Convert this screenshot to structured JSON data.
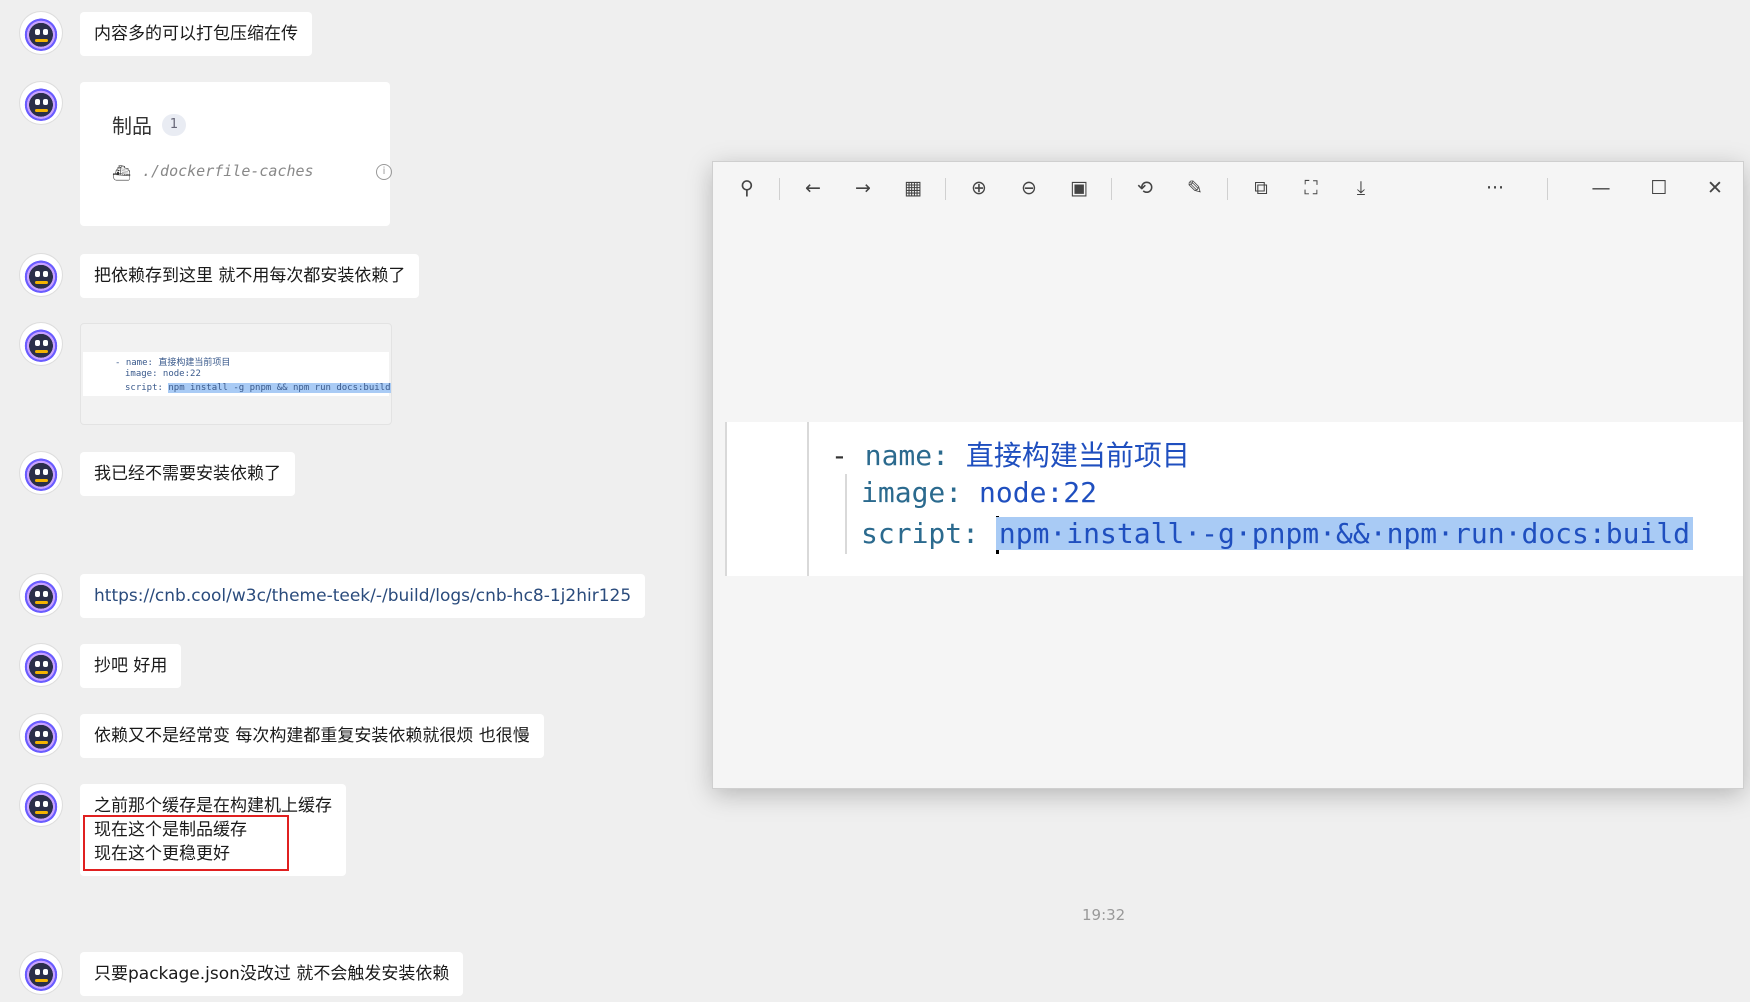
{
  "messages": [
    {
      "text": "内容多的可以打包压缩在传"
    },
    {
      "card": {
        "title": "制品",
        "count": "1",
        "path": "./dockerfile-caches"
      }
    },
    {
      "text": "把依赖存到这里 就不用每次都安装依赖了"
    },
    {
      "thumb": {
        "line1": "- name: 直接构建当前项目",
        "line2": "image: node:22",
        "line3_key": "script:",
        "line3_val": "npm install -g pnpm && npm run docs:build"
      }
    },
    {
      "text": "我已经不需要安装依赖了"
    },
    {
      "link": "https://cnb.cool/w3c/theme-teek/-/build/logs/cnb-hc8-1j2hir125"
    },
    {
      "text": "抄吧 好用"
    },
    {
      "text": "依赖又不是经常变 每次构建都重复安装依赖就很烦 也很慢"
    },
    {
      "lines": [
        "之前那个缓存是在构建机上缓存",
        "现在这个是制品缓存",
        "现在这个更稳更好"
      ]
    },
    {
      "text": "只要package.json没改过 就不会触发安装依赖"
    }
  ],
  "timestamp": "19:32",
  "viewer": {
    "icons": [
      "pin-icon",
      "back-icon",
      "forward-icon",
      "grid-icon",
      "zoom-in-icon",
      "zoom-out-icon",
      "actual-size-icon",
      "rotate-icon",
      "edit-icon",
      "ocr-icon",
      "screen-capture-icon",
      "download-icon",
      "more-icon",
      "minimize-icon",
      "maximize-icon",
      "close-icon"
    ],
    "glyphs": {
      "pin": "⚲",
      "back": "←",
      "forward": "→",
      "grid": "▦",
      "zin": "⊕",
      "zout": "⊖",
      "actual": "▣",
      "rotate": "⟲",
      "edit": "✎",
      "ocr": "⧉",
      "capture": "⛶",
      "download": "⤓",
      "more": "···",
      "min": "—",
      "max": "☐",
      "close": "✕"
    },
    "code": {
      "dash": "-",
      "name_key": "name:",
      "name_val": "直接构建当前项目",
      "image_key": "image:",
      "image_val": "node:22",
      "script_key": "script:",
      "script_val": "npm·install·-g·pnpm·&&·npm·run·docs:build"
    }
  }
}
